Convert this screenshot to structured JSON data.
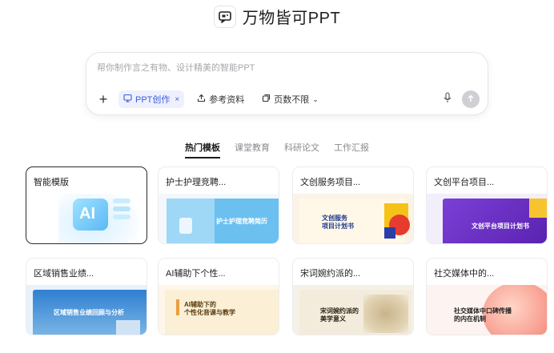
{
  "header": {
    "app_title": "万物皆可PPT",
    "logo_icon": "presentation-chat-icon"
  },
  "prompt": {
    "placeholder": "帮你制作言之有物、设计精美的智能PPT",
    "value": "",
    "chips": [
      {
        "label": "PPT创作",
        "active": true,
        "icon": "presentation-icon",
        "close": "×"
      },
      {
        "label": "参考资料",
        "active": false,
        "icon": "upload-icon"
      },
      {
        "label": "页数不限",
        "active": false,
        "icon": "pages-icon",
        "caret": "⌄"
      }
    ],
    "add_label": "+"
  },
  "tabs": [
    {
      "label": "热门模板",
      "active": true
    },
    {
      "label": "课堂教育",
      "active": false
    },
    {
      "label": "科研论文",
      "active": false
    },
    {
      "label": "工作汇报",
      "active": false
    }
  ],
  "cards": [
    {
      "title": "智能模版",
      "thumb_text": "AI"
    },
    {
      "title": "护士护理竞聘...",
      "thumb_text": "护士护理竞聘简历"
    },
    {
      "title": "文创服务项目...",
      "thumb_text": "文创服务\n项目计划书"
    },
    {
      "title": "文创平台项目...",
      "thumb_text": "文创平台项目计划书"
    },
    {
      "title": "区域销售业绩...",
      "thumb_text": "区域销售业绩回顾与分析"
    },
    {
      "title": "AI辅助下个性...",
      "thumb_text": "AI辅助下的\n个性化音课与教学"
    },
    {
      "title": "宋词婉约派的...",
      "thumb_text": "宋词婉约派的\n美学意义"
    },
    {
      "title": "社交媒体中的...",
      "thumb_text": "社交媒体中口碑传播\n的内在机制"
    }
  ],
  "colors": {
    "accent": "#3a5bd9",
    "purple": "#6b2ec2",
    "nurse_blue": "#4aa8e8",
    "sales_blue": "#2f80d1",
    "coral": "#f27a6b"
  }
}
